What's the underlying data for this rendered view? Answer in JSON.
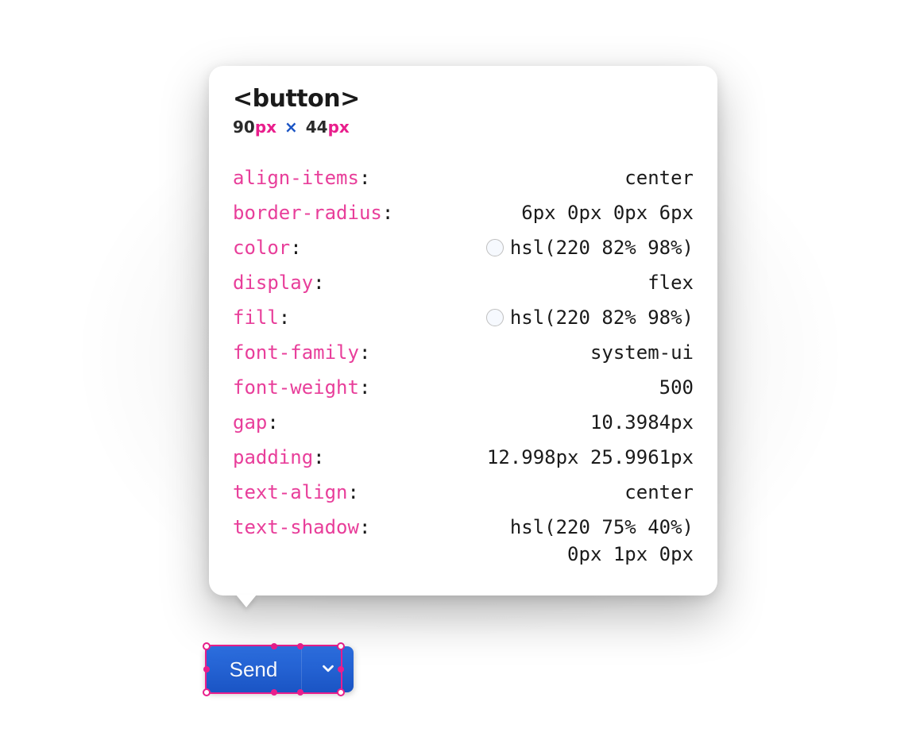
{
  "inspector": {
    "element_tag": "<button>",
    "dimensions": {
      "width": "90",
      "height": "44",
      "unit": "px",
      "sep": "×"
    },
    "properties": [
      {
        "name": "align-items",
        "value": "center"
      },
      {
        "name": "border-radius",
        "value": "6px 0px 0px 6px"
      },
      {
        "name": "color",
        "value": "hsl(220 82% 98%)",
        "swatch": "hsl(220 82% 98%)"
      },
      {
        "name": "display",
        "value": "flex"
      },
      {
        "name": "fill",
        "value": "hsl(220 82% 98%)",
        "swatch": "hsl(220 82% 98%)"
      },
      {
        "name": "font-family",
        "value": "system-ui"
      },
      {
        "name": "font-weight",
        "value": "500"
      },
      {
        "name": "gap",
        "value": "10.3984px"
      },
      {
        "name": "padding",
        "value": "12.998px 25.9961px"
      },
      {
        "name": "text-align",
        "value": "center"
      },
      {
        "name": "text-shadow",
        "value": "hsl(220 75% 40%)",
        "value2": "0px 1px 0px"
      }
    ]
  },
  "button": {
    "label": "Send"
  }
}
